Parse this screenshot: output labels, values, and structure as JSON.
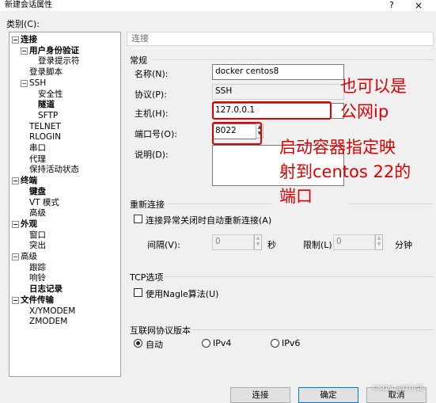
{
  "window": {
    "title": "新建会话属性",
    "help": "?",
    "close": "×"
  },
  "category_label": "类别(C):",
  "tree": [
    {
      "label": "连接",
      "bold": true,
      "expander": "−"
    },
    {
      "label": "用户身份验证",
      "bold": true,
      "expander": "−"
    },
    {
      "label": "登录提示符",
      "bold": false
    },
    {
      "label": "登录脚本",
      "bold": false
    },
    {
      "label": "SSH",
      "bold": false,
      "expander": "−"
    },
    {
      "label": "安全性",
      "bold": false
    },
    {
      "label": "隧道",
      "bold": true
    },
    {
      "label": "SFTP",
      "bold": false
    },
    {
      "label": "TELNET",
      "bold": false
    },
    {
      "label": "RLOGIN",
      "bold": false
    },
    {
      "label": "串口",
      "bold": false
    },
    {
      "label": "代理",
      "bold": false
    },
    {
      "label": "保持活动状态",
      "bold": false
    },
    {
      "label": "终端",
      "bold": true,
      "expander": "−"
    },
    {
      "label": "键盘",
      "bold": true
    },
    {
      "label": "VT 模式",
      "bold": false
    },
    {
      "label": "高级",
      "bold": false
    },
    {
      "label": "外观",
      "bold": true,
      "expander": "−"
    },
    {
      "label": "窗口",
      "bold": false
    },
    {
      "label": "突出",
      "bold": false
    },
    {
      "label": "高级",
      "bold": false,
      "expander": "−"
    },
    {
      "label": "跟踪",
      "bold": false
    },
    {
      "label": "响铃",
      "bold": false
    },
    {
      "label": "日志记录",
      "bold": true
    },
    {
      "label": "文件传输",
      "bold": true,
      "expander": "−"
    },
    {
      "label": "X/YMODEM",
      "bold": false
    },
    {
      "label": "ZMODEM",
      "bold": false
    }
  ],
  "panel_header": "连接",
  "general": {
    "group": "常规",
    "name_label": "名称(N):",
    "name_value": "docker centos8",
    "protocol_label": "协议(P):",
    "protocol_value": "SSH",
    "host_label": "主机(H):",
    "host_value": "127.0.0.1",
    "port_label": "端口号(O):",
    "port_value": "8022",
    "desc_label": "说明(D):",
    "desc_value": ""
  },
  "reconnect": {
    "group": "重新连接",
    "checkbox_label": "连接异常关闭时自动重新连接(A)",
    "interval_label": "间隔(V):",
    "interval_value": "0",
    "interval_unit": "秒",
    "limit_label": "限制(L):",
    "limit_value": "0",
    "limit_unit": "分钟"
  },
  "tcp": {
    "group": "TCP选项",
    "checkbox_label": "使用Nagle算法(U)"
  },
  "ipver": {
    "group": "互联网协议版本",
    "options": [
      "自动",
      "IPv4",
      "IPv6"
    ],
    "selected": "自动"
  },
  "annotations": {
    "host_note_1": "也可以是",
    "host_note_2": "公网ip",
    "port_note_1": "启动容器指定映",
    "port_note_2": "射到centos 22的",
    "port_note_3": "端口"
  },
  "buttons": {
    "connect": "连接",
    "ok": "确定",
    "cancel": "取消"
  },
  "watermark": "CSDN @IT小郭.",
  "colors": {
    "annotation_red": "#e00000"
  }
}
